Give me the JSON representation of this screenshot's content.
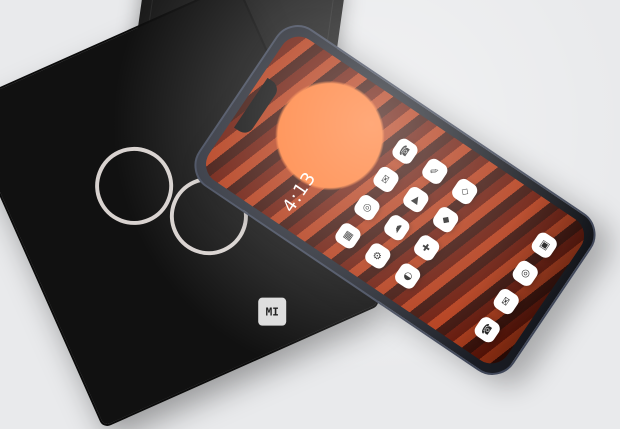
{
  "scene": {
    "description_note": "",
    "brand_logo_text": "MI",
    "phone_time": "4:13",
    "phone_date": "",
    "icons": [
      "app-icon",
      "app-icon",
      "app-icon",
      "app-icon",
      "app-icon",
      "app-icon",
      "app-icon",
      "app-icon",
      "app-icon",
      "app-icon",
      "app-icon",
      "app-icon",
      "app-icon",
      "app-icon",
      "app-icon",
      "app-icon"
    ],
    "colors": {
      "background": "#e9eaec",
      "box": "#111111",
      "ring": "#d8d2cf",
      "wallpaper_dark": "#3c0f07",
      "wallpaper_mid": "#b33a17",
      "wallpaper_light": "#ff7b32"
    }
  }
}
